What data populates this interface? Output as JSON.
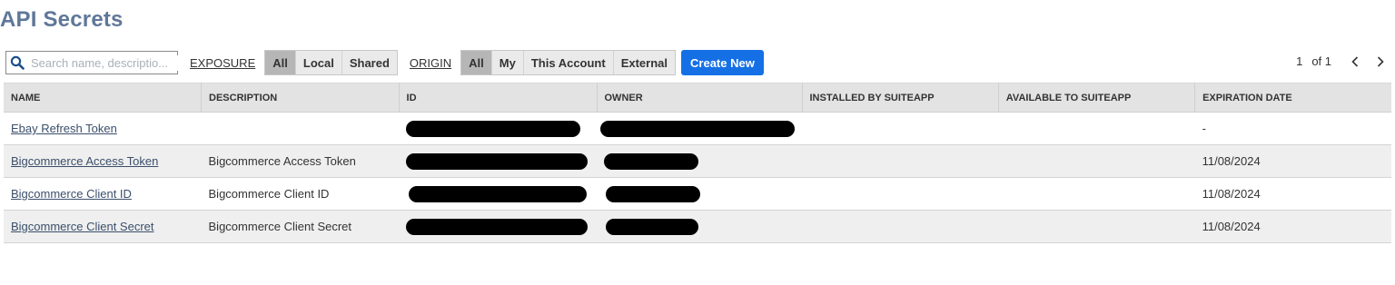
{
  "page": {
    "title": "API Secrets"
  },
  "toolbar": {
    "search_placeholder": "Search name, descriptio...",
    "exposure_label": "EXPOSURE",
    "exposure_options": [
      "All",
      "Local",
      "Shared"
    ],
    "origin_label": "ORIGIN",
    "origin_options": [
      "All",
      "My",
      "This Account",
      "External"
    ],
    "create_label": "Create New"
  },
  "pager": {
    "current": "1",
    "total": "of 1",
    "prev_icon": "chevron-left-icon",
    "next_icon": "chevron-right-icon"
  },
  "table": {
    "columns": [
      "NAME",
      "DESCRIPTION",
      "ID",
      "OWNER",
      "INSTALLED BY SUITEAPP",
      "AVAILABLE TO SUITEAPP",
      "EXPIRATION DATE"
    ],
    "rows": [
      {
        "name": "Ebay Refresh Token",
        "description": "",
        "installed_by": "",
        "available_to": "",
        "expiration": "-"
      },
      {
        "name": "Bigcommerce Access Token",
        "description": "Bigcommerce Access Token",
        "installed_by": "",
        "available_to": "",
        "expiration": "11/08/2024"
      },
      {
        "name": "Bigcommerce Client ID",
        "description": "Bigcommerce Client ID",
        "installed_by": "",
        "available_to": "",
        "expiration": "11/08/2024"
      },
      {
        "name": "Bigcommerce Client Secret",
        "description": "Bigcommerce Client Secret",
        "installed_by": "",
        "available_to": "",
        "expiration": "11/08/2024"
      }
    ]
  },
  "colors": {
    "title": "#607799",
    "accent": "#1570e6",
    "active_segment": "#b6b6b6",
    "redaction": "#000000"
  }
}
